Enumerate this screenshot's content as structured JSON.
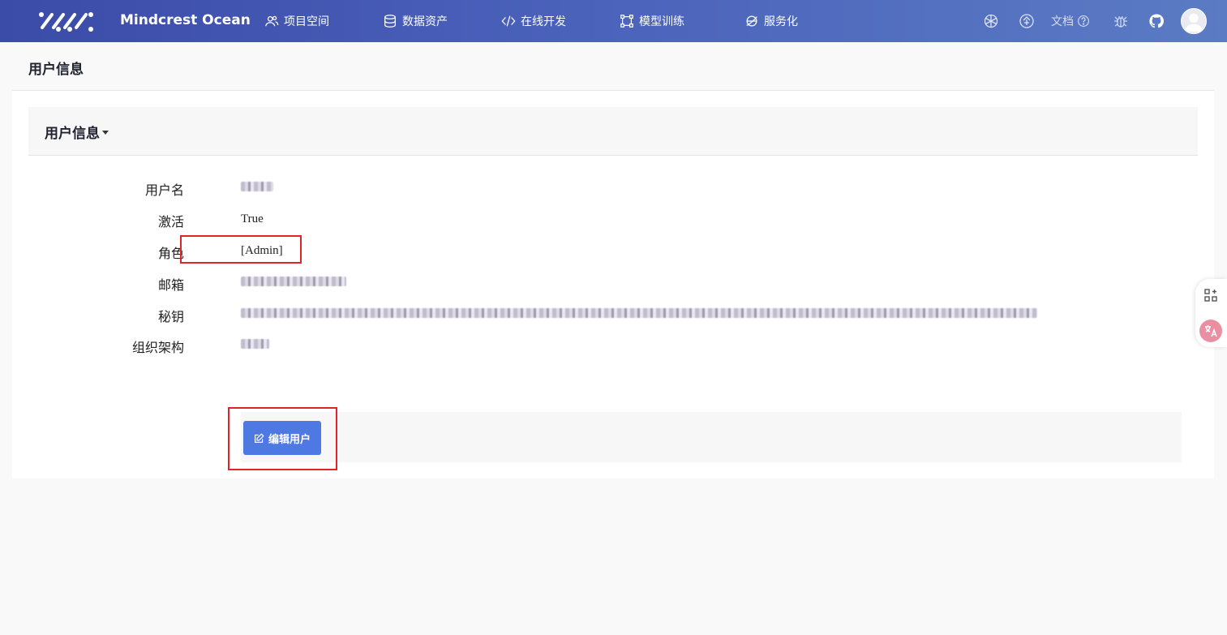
{
  "navbar": {
    "brand": "Mindcrest Ocean",
    "items": [
      {
        "label": "项目空间",
        "icon": "users-icon"
      },
      {
        "label": "数据资产",
        "icon": "database-icon"
      },
      {
        "label": "在线开发",
        "icon": "code-icon"
      },
      {
        "label": "模型训练",
        "icon": "model-icon"
      },
      {
        "label": "服务化",
        "icon": "ie-globe-icon"
      }
    ],
    "right_icons": [
      "openai-icon",
      "enterprise-icon",
      "bug-icon",
      "github-icon"
    ],
    "docs_label": "文档",
    "colors": {
      "gradient_start": "#3b4ba8",
      "gradient_end": "#5b7bc4"
    }
  },
  "page": {
    "title": "用户信息"
  },
  "panel": {
    "title": "用户信息",
    "fields": [
      {
        "label": "用户名",
        "value": "",
        "redacted": true
      },
      {
        "label": "激活",
        "value": "True",
        "redacted": false
      },
      {
        "label": "角色",
        "value": "[Admin]",
        "redacted": false
      },
      {
        "label": "邮箱",
        "value": "",
        "redacted": true
      },
      {
        "label": "秘钥",
        "value": "",
        "redacted": true
      },
      {
        "label": "组织架构",
        "value": "",
        "redacted": true
      }
    ],
    "edit_button_label": "编辑用户",
    "edit_button_color": "#4e79e3",
    "highlight_color": "#e0242a"
  },
  "side_tools": [
    "grid-add-icon",
    "translate-icon"
  ]
}
